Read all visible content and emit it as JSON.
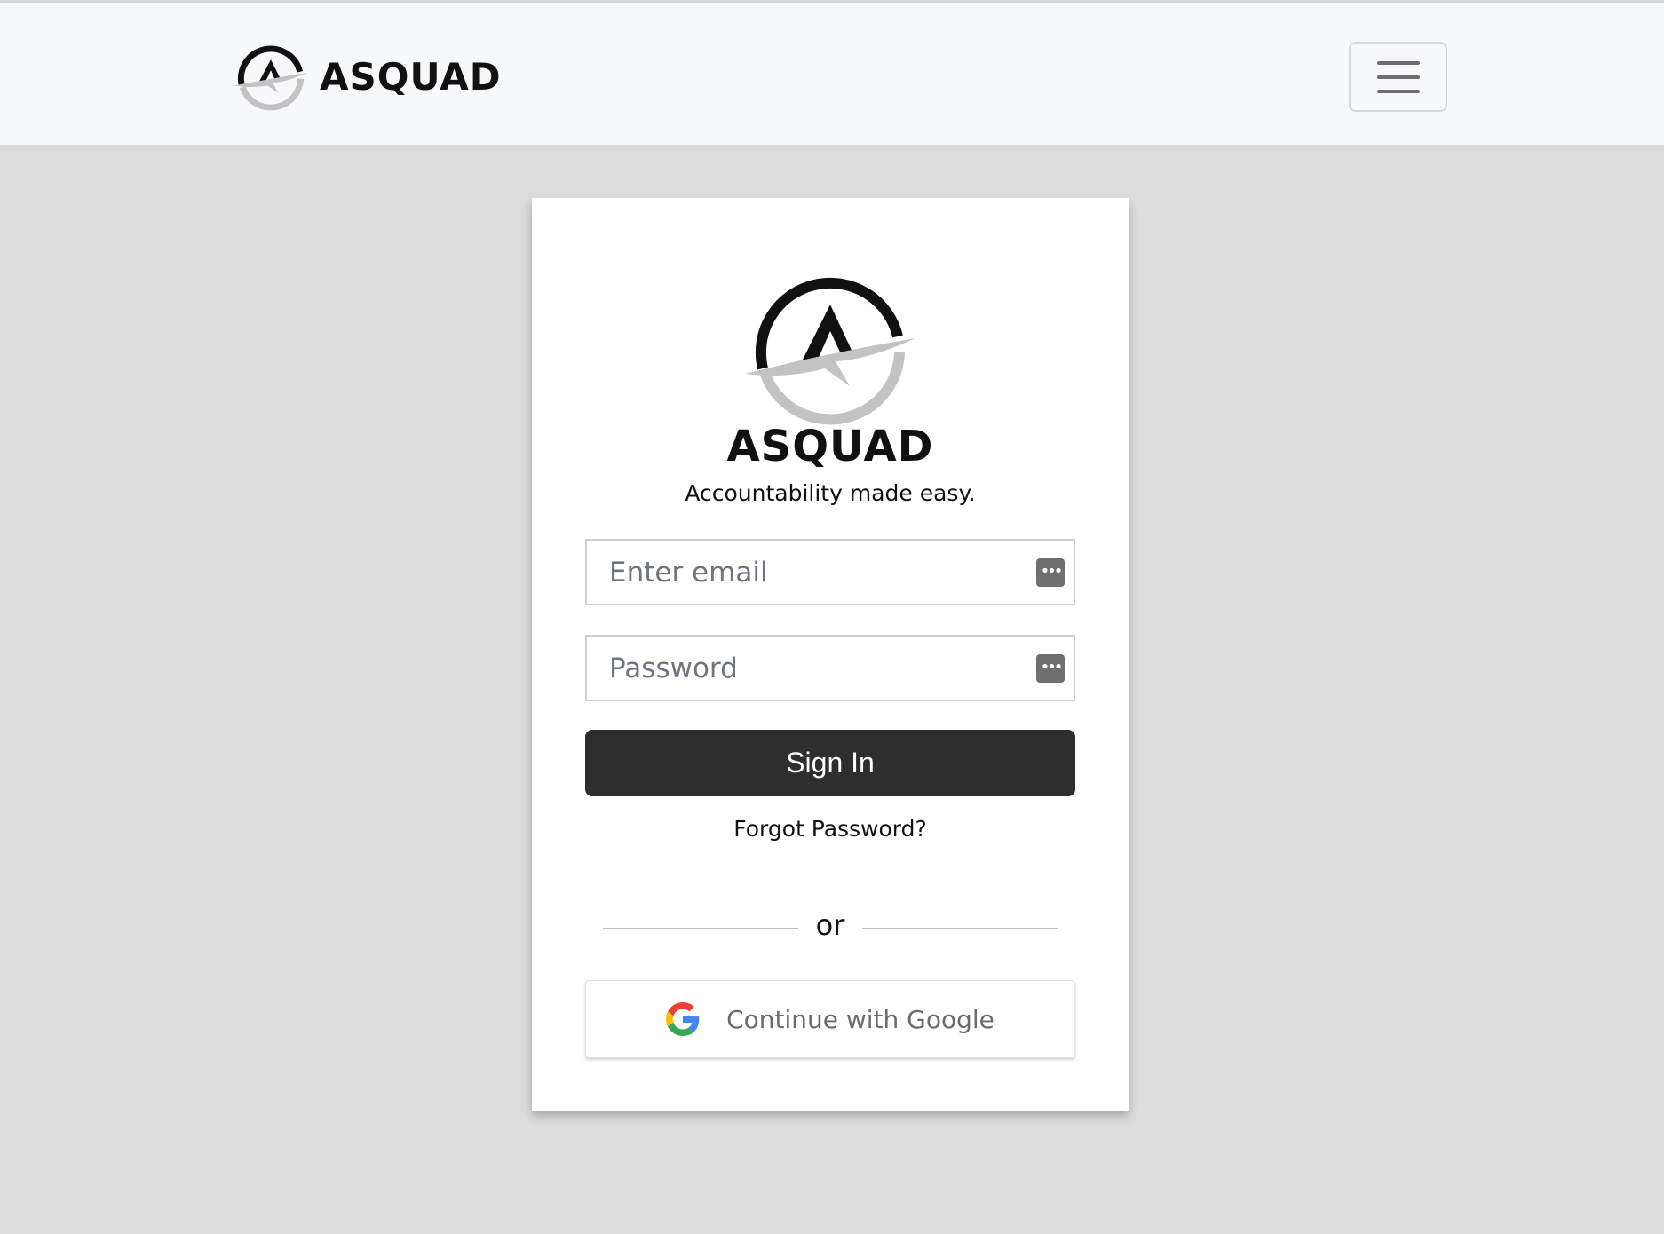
{
  "navbar": {
    "brand_name": "ASQUAD",
    "logo_icon": "asquad-logo",
    "menu_icon": "hamburger-menu-icon"
  },
  "card": {
    "title": "ASQUAD",
    "tagline": "Accountability made easy.",
    "email_placeholder": "Enter email",
    "password_placeholder": "Password",
    "password_manager_icon": "password-manager-icon",
    "signin_label": "Sign In",
    "forgot_label": "Forgot Password?",
    "divider_label": "or",
    "google_label": "Continue with Google",
    "google_icon": "google-g-icon"
  },
  "colors": {
    "page_background": "#dcdcdc",
    "navbar_background": "#f7f8f9",
    "signin_button": "#2f2e2f",
    "logo_dark": "#111111",
    "logo_gray": "#c3c3c3"
  }
}
